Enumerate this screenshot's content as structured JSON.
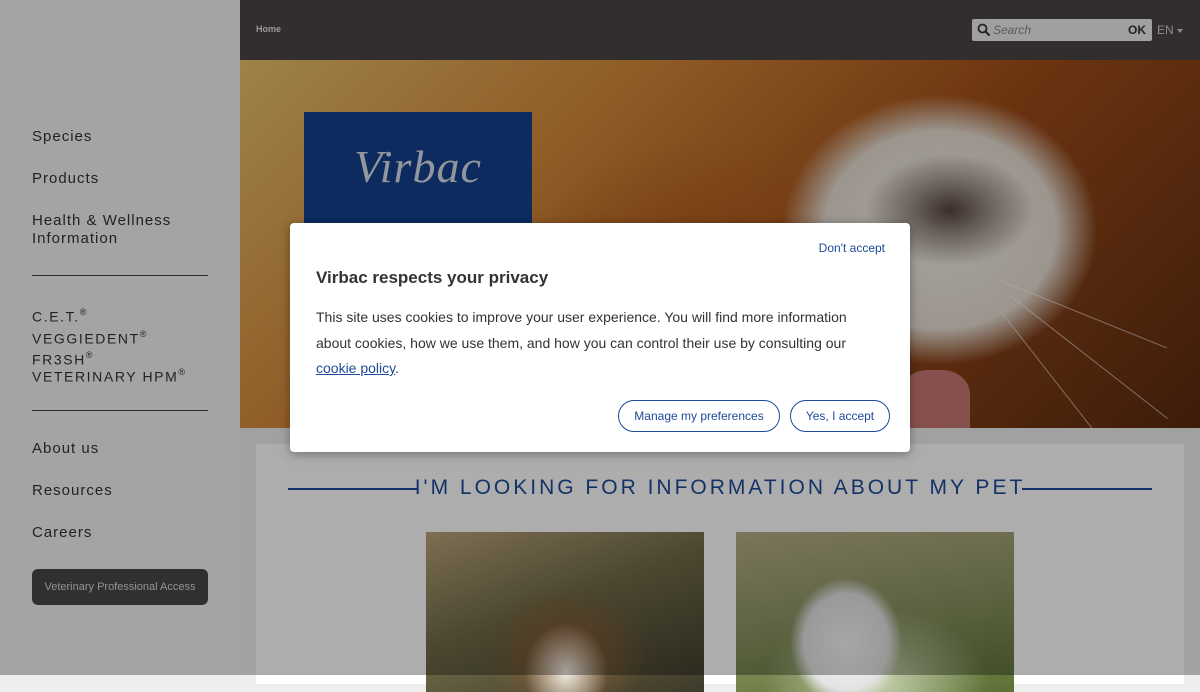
{
  "sidebar": {
    "items": [
      {
        "label": "Species"
      },
      {
        "label": "Products"
      },
      {
        "label": "Health & Wellness Information"
      }
    ],
    "brand_items": [
      {
        "label": "C.E.T.",
        "reg": "®",
        "label2": " VEGGIEDENT",
        "reg2": "®",
        "label3": " FR3SH",
        "reg3": "®"
      },
      {
        "label": "VETERINARY HPM",
        "reg": "®"
      }
    ],
    "info_items": [
      {
        "label": "About us"
      },
      {
        "label": "Resources"
      },
      {
        "label": "Careers"
      }
    ],
    "pro_access_label": "Veterinary Professional Access"
  },
  "topbar": {
    "breadcrumb": "Home",
    "search_placeholder": "Search",
    "search_button": "OK",
    "language": "EN"
  },
  "hero": {
    "logo_text": "Virbac"
  },
  "content": {
    "heading": "I'M LOOKING FOR INFORMATION ABOUT MY PET"
  },
  "cookie_modal": {
    "dont_accept": "Don't accept",
    "title": "Virbac respects your privacy",
    "body": "This site uses cookies to improve your user experience. You will find more information about cookies, how we use them, and how you can control their use by consulting our ",
    "policy_link": "cookie policy",
    "period": ".",
    "manage_button": "Manage my preferences",
    "accept_button": "Yes, I accept"
  },
  "colors": {
    "brand_blue": "#14408c",
    "link_blue": "#1d4a98",
    "topbar": "#4a4543",
    "sidebar": "#f2f2f2"
  }
}
